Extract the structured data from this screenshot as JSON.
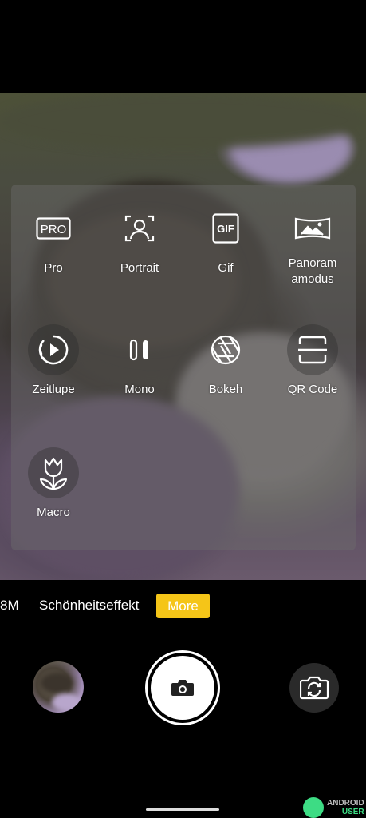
{
  "modes": [
    {
      "id": "pro",
      "label": "Pro",
      "icon": "pro-badge-icon"
    },
    {
      "id": "portrait",
      "label": "Portrait",
      "icon": "portrait-icon"
    },
    {
      "id": "gif",
      "label": "Gif",
      "icon": "gif-icon"
    },
    {
      "id": "panorama",
      "label": "Panoram\namodus",
      "icon": "panorama-icon"
    },
    {
      "id": "zeitlupe",
      "label": "Zeitlupe",
      "icon": "slow-motion-icon"
    },
    {
      "id": "mono",
      "label": "Mono",
      "icon": "mono-icon"
    },
    {
      "id": "bokeh",
      "label": "Bokeh",
      "icon": "aperture-icon"
    },
    {
      "id": "qrcode",
      "label": "QR Code",
      "icon": "qr-scan-icon"
    },
    {
      "id": "macro",
      "label": "Macro",
      "icon": "tulip-icon"
    }
  ],
  "modebar": {
    "left_partial": "8M",
    "beauty": "Schönheitseffekt",
    "more": "More"
  },
  "more_color": "#f5c518",
  "watermark": {
    "line1": "ANDROID",
    "line2": "USER"
  }
}
